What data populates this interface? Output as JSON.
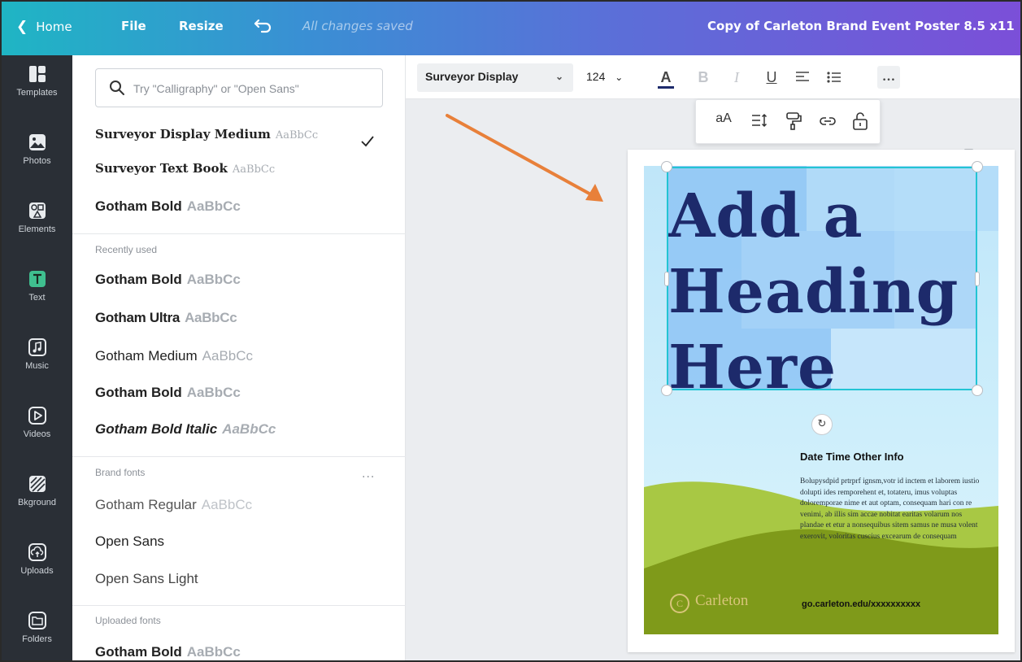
{
  "topbar": {
    "home": "Home",
    "file": "File",
    "resize": "Resize",
    "saved": "All changes saved",
    "title": "Copy of Carleton Brand Event Poster 8.5 x11"
  },
  "rail": [
    {
      "label": "Templates",
      "icon": "templates-icon"
    },
    {
      "label": "Photos",
      "icon": "photos-icon"
    },
    {
      "label": "Elements",
      "icon": "elements-icon"
    },
    {
      "label": "Text",
      "icon": "text-icon"
    },
    {
      "label": "Music",
      "icon": "music-icon"
    },
    {
      "label": "Videos",
      "icon": "videos-icon"
    },
    {
      "label": "Bkground",
      "icon": "background-icon"
    },
    {
      "label": "Uploads",
      "icon": "uploads-icon"
    },
    {
      "label": "Folders",
      "icon": "folders-icon"
    }
  ],
  "panel": {
    "search_placeholder": "Try \"Calligraphy\" or \"Open Sans\"",
    "top_fonts": [
      {
        "name": "Surveyor Display Medium",
        "sample": "AaBbCc"
      },
      {
        "name": "Surveyor Text Book",
        "sample": "AaBbCc"
      },
      {
        "name": "Gotham Bold",
        "sample": "AaBbCc"
      }
    ],
    "recently_used_label": "Recently used",
    "recent_fonts": [
      {
        "name": "Gotham Bold",
        "sample": "AaBbCc"
      },
      {
        "name": "Gotham Ultra",
        "sample": "AaBbCc"
      },
      {
        "name": "Gotham Medium",
        "sample": "AaBbCc"
      },
      {
        "name": "Gotham Bold",
        "sample": "AaBbCc"
      },
      {
        "name": "Gotham Bold Italic",
        "sample": "AaBbCc"
      }
    ],
    "brand_fonts_label": "Brand fonts",
    "brand_more": "...",
    "brand_fonts": [
      {
        "name": "Gotham Regular",
        "sample": "AaBbCc"
      },
      {
        "name": "Open Sans",
        "sample": ""
      },
      {
        "name": "Open Sans Light",
        "sample": ""
      }
    ],
    "uploaded_fonts_label": "Uploaded fonts",
    "uploaded_fonts": [
      {
        "name": "Gotham Bold",
        "sample": "AaBbCc"
      }
    ]
  },
  "toolbar": {
    "font": "Surveyor Display",
    "size": "124",
    "more": "…",
    "text_color": "#1d2a6b"
  },
  "subbar": {
    "letter_case": "aA"
  },
  "poster": {
    "heading": [
      "Add a",
      "Heading",
      "Here"
    ],
    "date_info": "Date Time Other Info",
    "body": "Bolupysdpid prtrprf ignsm,votr id inctem et laborem iustio dolupti ides remporehent et, totateru, imus voluptas doloremporae nime et aut optam, consequam hari con re venimi, ab illis sim accae nobitat earitas volarum nos plandae et etur a nonsequibus sitem samus ne musa volent exerovit, voloritas cuscius excearum de consequam",
    "logo_text": "Carleton",
    "url": "go.carleton.edu/xxxxxxxxxx"
  },
  "colors": {
    "heading": "#1d2a6b",
    "selection": "#23c4d4",
    "arrow": "#e8803a",
    "grass_light": "#a8c844",
    "grass_dark": "#7f9a1a",
    "carleton_gold": "#d8c57a"
  }
}
